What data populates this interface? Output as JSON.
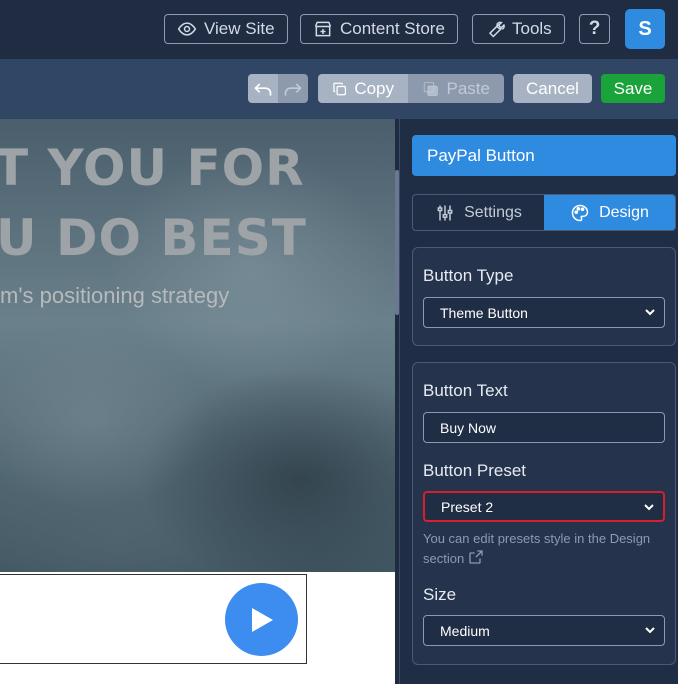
{
  "topbar": {
    "view_site": "View Site",
    "content_store": "Content Store",
    "tools": "Tools",
    "help": "?",
    "avatar_initial": "S"
  },
  "toolbar": {
    "copy": "Copy",
    "paste": "Paste",
    "cancel": "Cancel",
    "save": "Save"
  },
  "canvas": {
    "hero_line1": "T YOU FOR",
    "hero_line2": "U DO BEST",
    "hero_sub": "m's positioning strategy"
  },
  "panel": {
    "title": "PayPal Button",
    "tabs": [
      {
        "label": "Settings",
        "icon": "sliders-icon",
        "active": false
      },
      {
        "label": "Design",
        "icon": "palette-icon",
        "active": true
      }
    ],
    "button_type": {
      "label": "Button Type",
      "value": "Theme Button"
    },
    "button_text": {
      "label": "Button Text",
      "value": "Buy Now"
    },
    "button_preset": {
      "label": "Button Preset",
      "value": "Preset 2"
    },
    "hint": "You can edit presets style in the Design section",
    "size": {
      "label": "Size",
      "value": "Medium"
    }
  },
  "colors": {
    "accent": "#2f8be0",
    "save": "#1aa33a",
    "highlight": "#d8202a"
  }
}
